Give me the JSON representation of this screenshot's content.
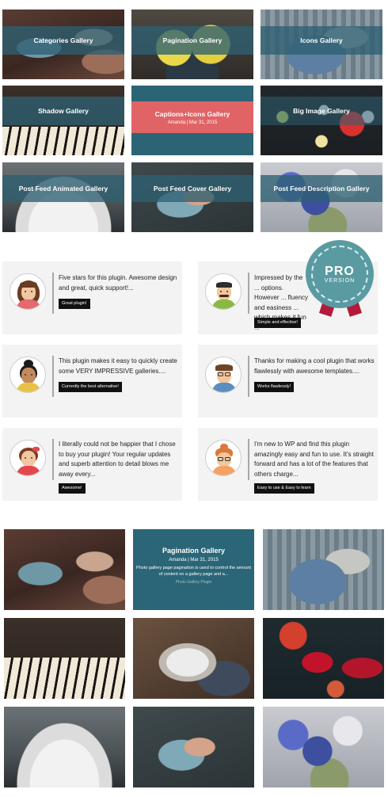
{
  "top_gallery": [
    {
      "title": "Categories Gallery",
      "photo": "tea-and-cookies"
    },
    {
      "title": "Pagination Gallery",
      "photo": "lemons-bowl"
    },
    {
      "title": "Icons Gallery",
      "photo": "hammock-blanket"
    },
    {
      "title": "Shadow Gallery",
      "photo": "old-piano"
    },
    {
      "title": "Captions+Icons Gallery",
      "subtitle": "Amanda | Mar 31, 2015"
    },
    {
      "title": "Big Image Gallery",
      "photo": "lamps-dark"
    },
    {
      "title": "Post Feed Animated Gallery",
      "photo": "record-player"
    },
    {
      "title": "Post Feed Cover Gallery",
      "photo": "guitar-hands"
    },
    {
      "title": "Post Feed Description Gallery",
      "photo": "blue-flowers"
    }
  ],
  "testimonials": [
    {
      "text": "Five stars for this plugin. Awesome design and great, quick support!...",
      "tag": "Great plugin!",
      "avatar": "woman-brown-hair-icon"
    },
    {
      "text": "Impressed by the ... options. However ... fluency and easiness ... which makes it fun ...",
      "tag": "Simple and effective!",
      "avatar": "man-mustache-icon"
    },
    {
      "text": "This plugin makes it easy to quickly create some VERY IMPRESSIVE galleries....",
      "tag": "Currently the best alternative!",
      "avatar": "woman-bun-icon"
    },
    {
      "text": "Thanks for making a cool plugin that works flawlessly with awesome templates....",
      "tag": "Works flawlessly!",
      "avatar": "man-glasses-icon"
    },
    {
      "text": "I literally could not be happier that I chose to buy your plugin! Your regular updates and superb attention to detail blows me away every...",
      "tag": "Awesome!",
      "avatar": "girl-bow-icon"
    },
    {
      "text": "I'm new to WP and find this plugin amazingly easy and fun to use. It's straight forward and has a lot of the features that others charge...",
      "tag": "Easy to use & Easy to learn",
      "avatar": "woman-redhead-glasses-icon"
    }
  ],
  "pro_badge": {
    "line1": "PRO",
    "line2": "VERSION",
    "color": "#5a9ba2",
    "ribbon_color": "#b31b3b"
  },
  "pagination_gallery": {
    "title": "Pagination Gallery",
    "meta": "Amanda | Mar 31, 2015",
    "description": "Photo gallery page pagination is used to control the amount of content on a gallery page and a...",
    "footer": "Photo Gallery Plugin",
    "photos": [
      "tea-and-cookies",
      "hammock-blanket",
      "old-piano",
      "cat-playing",
      "popsicles",
      "record-player",
      "guitar-hands",
      "blue-flowers"
    ]
  },
  "colors": {
    "accent_teal": "#2b6475",
    "accent_coral": "#e06366",
    "card_bg": "#f3f3f3"
  }
}
